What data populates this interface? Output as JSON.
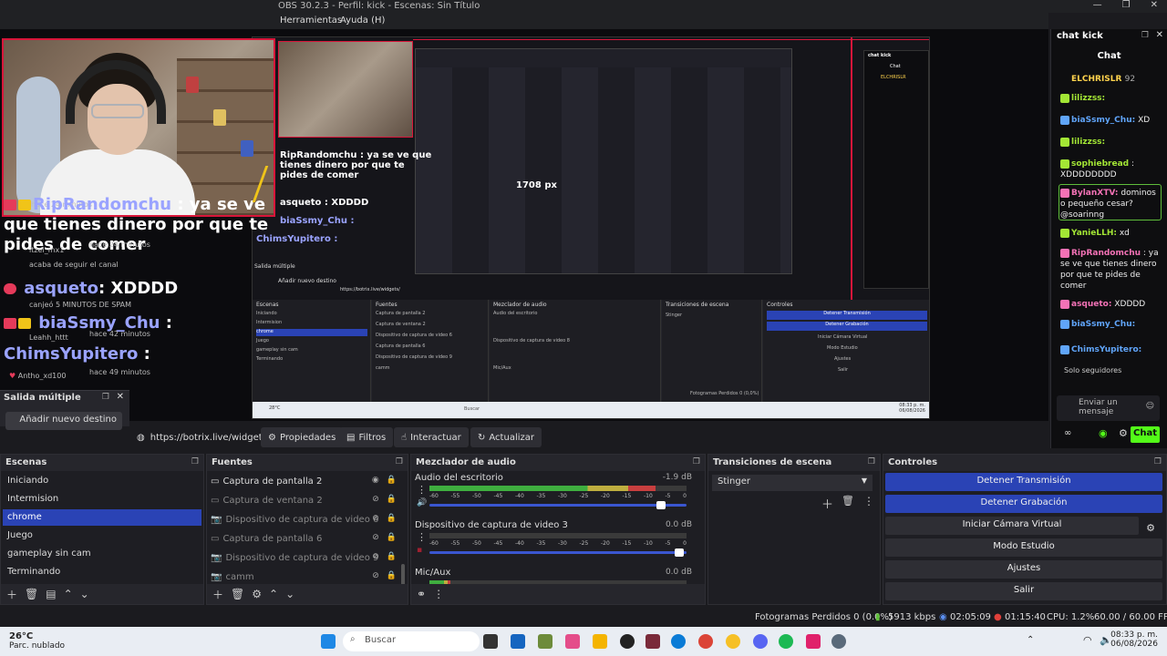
{
  "window": {
    "title": "OBS 30.2.3 - Perfil: kick - Escenas: Sin Título",
    "controls": [
      "—",
      "❐",
      "✕"
    ]
  },
  "menu": {
    "items": [
      "Herramientas",
      "Ayuda (H)"
    ]
  },
  "overlay_chat": {
    "lines": [
      {
        "user": "RipRandomchu",
        "text": ": ya se ve que tienes dinero por que te pides de comer"
      },
      {
        "user": "asqueto",
        "text": ": XDDDD"
      },
      {
        "user": "biaSsmy_Chu",
        "text": ":"
      },
      {
        "user": "ChimsYupitero",
        "text": ":"
      }
    ],
    "events": [
      {
        "user": "itzel_mx1",
        "ago": "hace 24 minutos",
        "msg": "acaba de seguir el canal"
      },
      {
        "user": "Leahh_httt",
        "ago": "hace 42 minutos",
        "msg": "canjeó 5 MINUTOS DE SPAM"
      },
      {
        "user": "Antho_xd100",
        "ago": "hace 49 minutos",
        "msg": ""
      }
    ],
    "top_event": {
      "ago": "hace 24 minutos",
      "msg": "acaba de seguir el canal"
    }
  },
  "nested": {
    "big_chat": "RipRandomchu : ya se ve que tienes dinero por que te pides de comer",
    "resolution": "1708 px",
    "asqueto": "asqueto : XDDDD",
    "bia": "biaSsmy_Chu :",
    "chims": "ChimsYupitero :",
    "salida": "Salida múltiple",
    "anadir": "Añadir nuevo destino",
    "url": "https://botrix.live/widgets/",
    "props": "Propiedades",
    "filtros": "Filtros",
    "actualizar": "Actualizar",
    "escenas": "Escenas",
    "fuentes": "Fuentes",
    "mezclador": "Mezclador de audio",
    "transiciones": "Transiciones de escena",
    "controles": "Controles",
    "scenes": [
      "Iniciando",
      "Intermision",
      "chrome",
      "Juego",
      "gameplay sin cam",
      "Terminando"
    ],
    "sources": [
      "Captura de pantalla 2",
      "Captura de ventana 2",
      "Dispositivo de captura de video 6",
      "Captura de pantalla 6",
      "Dispositivo de captura de video 9",
      "camm"
    ],
    "mixer": [
      "Audio del escritorio",
      "Dispositivo de captura de video 8",
      "Mic/Aux"
    ],
    "stinger": "Stinger",
    "ctrl": [
      "Detener Transmisión",
      "Detener Grabación",
      "Iniciar Cámara Virtual",
      "Modo Estudio",
      "Ajustes",
      "Salir"
    ],
    "status": "Fotogramas Perdidos 0 (0,0%)",
    "weather": "28°C",
    "search": "Buscar",
    "time": "08:33 p. m.",
    "date": "06/08/2026",
    "chat_title": "chat kick",
    "chat_tab": "Chat",
    "chat_top": "ELCHRISLR",
    "chat_lines": [
      "asqueto",
      "biaSsmy_Chu",
      "XD",
      "sophiebread",
      "XDDDDDDD",
      "BylanXTV",
      "YanieLLH: xd",
      "RipRandomchu",
      "asqueto: XDDDD",
      "biaSsmy_Chu",
      "ChimsYupitero"
    ],
    "solo": "Solo seguidores",
    "enviar": "Enviar un mensaje",
    "chat_btn": "Chat"
  },
  "multi_output": {
    "title": "Salida múltiple",
    "add_button": "Añadir nuevo destino"
  },
  "toolbar": {
    "url": "https://botrix.live/widgets/",
    "properties": "Propiedades",
    "filters": "Filtros",
    "interact": "Interactuar",
    "refresh": "Actualizar"
  },
  "scenes": {
    "title": "Escenas",
    "items": [
      "Iniciando",
      "Intermision",
      "chrome",
      "Juego",
      "gameplay sin cam",
      "Terminando"
    ],
    "active_index": 2
  },
  "sources": {
    "title": "Fuentes",
    "items": [
      {
        "name": "Captura de pantalla 2",
        "visible": true
      },
      {
        "name": "Captura de ventana 2",
        "visible": false
      },
      {
        "name": "Dispositivo de captura de video 6",
        "visible": false
      },
      {
        "name": "Captura de pantalla 6",
        "visible": false
      },
      {
        "name": "Dispositivo de captura de video 9",
        "visible": false
      },
      {
        "name": "camm",
        "visible": false
      }
    ]
  },
  "mixer": {
    "title": "Mezclador de audio",
    "channels": [
      {
        "name": "Audio del escritorio",
        "db": "-1.9 dB",
        "level": 0.88,
        "volume": 0.9
      },
      {
        "name": "Dispositivo de captura de video 3",
        "db": "0.0 dB",
        "level": 0.0,
        "volume": 0.97
      },
      {
        "name": "Mic/Aux",
        "db": "0.0 dB",
        "level": 0.08,
        "volume": 0.95
      }
    ],
    "scale": [
      "-60",
      "-55",
      "-50",
      "-45",
      "-40",
      "-35",
      "-30",
      "-25",
      "-20",
      "-15",
      "-10",
      "-5",
      "0"
    ]
  },
  "transitions": {
    "title": "Transiciones de escena",
    "selected": "Stinger"
  },
  "controls": {
    "title": "Controles",
    "buttons": [
      {
        "label": "Detener Transmisión",
        "active": true
      },
      {
        "label": "Detener Grabación",
        "active": true
      },
      {
        "label": "Iniciar Cámara Virtual",
        "active": false
      },
      {
        "label": "Modo Estudio",
        "active": false
      },
      {
        "label": "Ajustes",
        "active": false
      },
      {
        "label": "Salir",
        "active": false
      }
    ]
  },
  "status": {
    "dropped": "Fotogramas Perdidos 0 (0.0%)",
    "bitrate": "5913 kbps",
    "stream_time": "02:05:09",
    "rec_time": "01:15:40",
    "cpu": "CPU: 1.2%",
    "fps": "60.00 / 60.00 FPS"
  },
  "taskbar": {
    "temp": "26°C",
    "weather": "Parc. nublado",
    "search": "Buscar",
    "time": "08:33 p. m.",
    "date": "06/08/2026"
  },
  "chat": {
    "dock_title": "chat kick",
    "tab": "Chat",
    "top_user": "ELCHRISLR",
    "top_count": "92",
    "messages": [
      {
        "user": "lilizzss:",
        "text": "",
        "color": "#a3e635"
      },
      {
        "user": "biaSsmy_Chu:",
        "text": "XD",
        "color": "#60a5fa"
      },
      {
        "user": "lilizzss:",
        "text": "",
        "color": "#a3e635"
      },
      {
        "user": "sophiebread",
        "text": ": XDDDDDDDD",
        "color": "#a3e635"
      },
      {
        "user": "BylanXTV:",
        "text": "dominos o pequeño cesar? @soarinng",
        "color": "#f472b6"
      },
      {
        "user": "YanieLLH:",
        "text": "xd",
        "color": "#a3e635"
      },
      {
        "user": "RipRandomchu",
        "text": ": ya se ve que tienes dinero por que te pides de comer",
        "color": "#f472b6"
      },
      {
        "user": "asqueto:",
        "text": "XDDDD",
        "color": "#f472b6"
      },
      {
        "user": "biaSsmy_Chu:",
        "text": "",
        "color": "#60a5fa"
      },
      {
        "user": "ChimsYupitero:",
        "text": "",
        "color": "#60a5fa"
      }
    ],
    "followers_only": "Solo seguidores",
    "input_placeholder": "Enviar un mensaje",
    "send": "Chat"
  },
  "colors": {
    "accent": "#2a43b5",
    "kick_green": "#53fc18",
    "red_border": "#d8163a"
  }
}
